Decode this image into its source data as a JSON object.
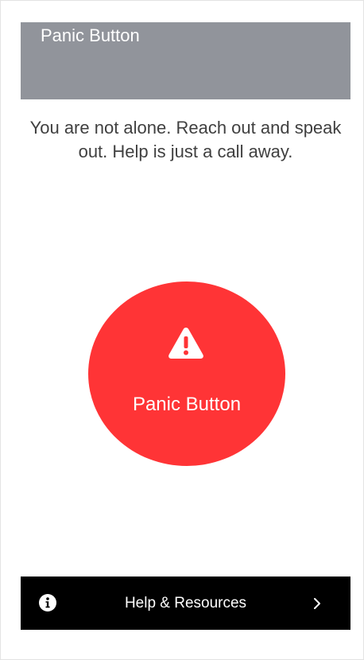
{
  "header": {
    "title": "Panic Button",
    "background_color": "#91949b"
  },
  "tagline": "You are not alone. Reach out and speak out. Help is just a call away.",
  "panic_button": {
    "label": "Panic Button",
    "icon": "warning-triangle-icon",
    "color": "#ff3436"
  },
  "help_bar": {
    "label": "Help & Resources",
    "leading_icon": "info-icon",
    "trailing_icon": "chevron-right-icon",
    "background_color": "#000000"
  }
}
